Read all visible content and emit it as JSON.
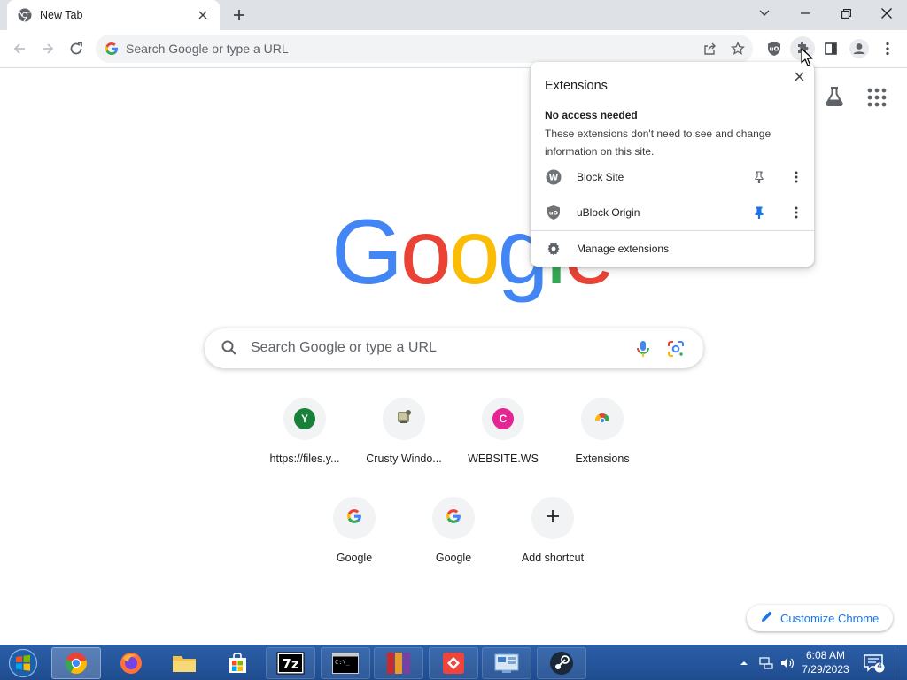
{
  "tab": {
    "title": "New Tab",
    "favicon": "chrome-icon"
  },
  "toolbar": {
    "omnibox_placeholder": "Search Google or type a URL",
    "icons": [
      "back-icon",
      "forward-icon",
      "reload-icon",
      "share-icon",
      "bookmark-star-icon",
      "ublock-icon",
      "extensions-puzzle-icon",
      "side-panel-icon",
      "profile-icon",
      "menu-icon"
    ]
  },
  "extensions_popup": {
    "title": "Extensions",
    "subheading": "No access needed",
    "description": "These extensions don't need to see and change information on this site.",
    "items": [
      {
        "name": "Block Site",
        "icon": "blocksite-icon",
        "pinned": false
      },
      {
        "name": "uBlock Origin",
        "icon": "ublock-icon",
        "pinned": true
      }
    ],
    "manage_label": "Manage extensions"
  },
  "ntp": {
    "logo_letters": [
      "G",
      "o",
      "o",
      "g",
      "l",
      "e"
    ],
    "logo_colors": [
      "#4285f4",
      "#ea4335",
      "#fbbc05",
      "#4285f4",
      "#34a853",
      "#ea4335"
    ],
    "search_placeholder": "Search Google or type a URL",
    "shortcuts": [
      {
        "label": "https://files.y...",
        "letter": "Y",
        "color": "#188038"
      },
      {
        "label": "Crusty Windo...",
        "icon": "crusty-icon"
      },
      {
        "label": "WEBSITE.WS",
        "letter": "C",
        "color": "#e52592"
      },
      {
        "label": "Extensions",
        "icon": "chrome-extensions-icon"
      },
      {
        "label": "Google",
        "icon": "google-g-icon"
      },
      {
        "label": "Google",
        "icon": "google-g-icon"
      },
      {
        "label": "Add shortcut",
        "icon": "plus-icon"
      }
    ],
    "customize_label": "Customize Chrome"
  },
  "taskbar": {
    "apps": [
      "chrome",
      "firefox",
      "file-explorer",
      "store",
      "7zip",
      "cmd",
      "winrar",
      "anydesk",
      "control-panel",
      "steam"
    ],
    "time": "6:08 AM",
    "date": "7/29/2023",
    "notification_count": "4"
  },
  "colors": {
    "accent": "#1a73e8",
    "taskbar": "#1f4c8f"
  }
}
